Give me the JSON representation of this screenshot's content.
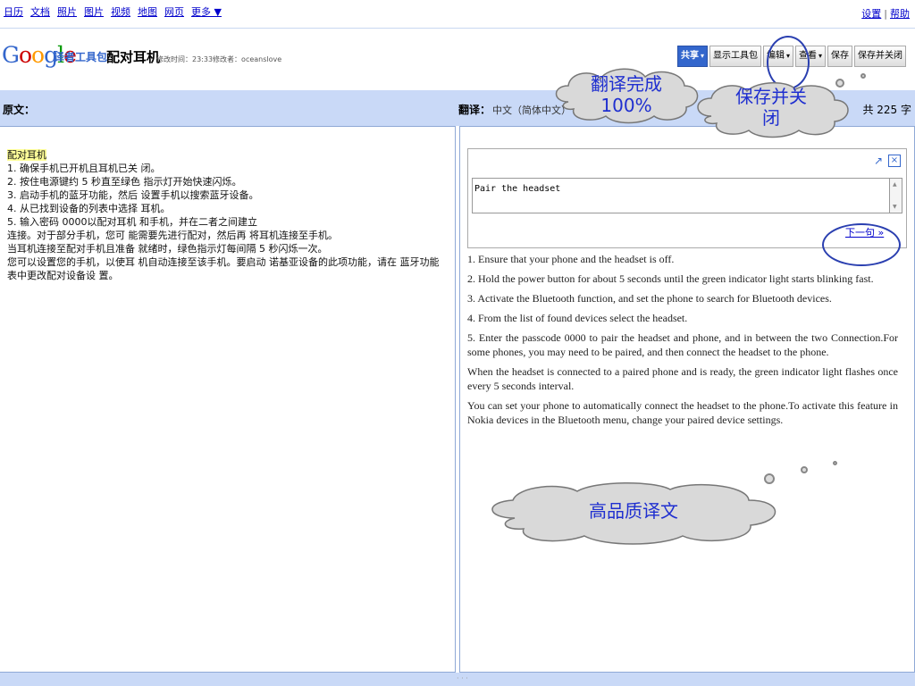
{
  "nav": {
    "links": [
      "日历",
      "文档",
      "照片",
      "图片",
      "视频",
      "地图",
      "网页",
      "更多 ▼"
    ],
    "settings": "设置",
    "sep": "|",
    "help": "帮助"
  },
  "header": {
    "logo_letters": [
      {
        "ch": "G",
        "color": "#3366cc"
      },
      {
        "ch": "o",
        "color": "#cc0000"
      },
      {
        "ch": "o",
        "color": "#ff9900"
      },
      {
        "ch": "g",
        "color": "#3366cc"
      },
      {
        "ch": "l",
        "color": "#009900"
      },
      {
        "ch": "e",
        "color": "#cc0000"
      }
    ],
    "toolkit": "译者工具包",
    "doc_title": "配对耳机",
    "meta": "修改时间：23:33修改者：oceanslove"
  },
  "toolbar": {
    "share": "共享",
    "show_toolkit": "显示工具包",
    "edit": "编辑",
    "view": "查看",
    "save": "保存",
    "save_close": "保存并关闭",
    "dropdown": "▾"
  },
  "columns": {
    "source_label": "原文：",
    "translation_label": "翻译：",
    "language": "中文（简体中文）",
    "word_count": "共 225 字"
  },
  "source": {
    "title": "配对耳机",
    "lines": [
      "1. 确保手机已开机且耳机已关 闭。",
      "2. 按住电源键约 5 秒直至绿色 指示灯开始快速闪烁。",
      "3. 启动手机的蓝牙功能，然后 设置手机以搜索蓝牙设备。",
      "4. 从已找到设备的列表中选择 耳机。",
      "5. 输入密码 0000以配对耳机 和手机，并在二者之间建立",
      "连接。对于部分手机，您可 能需要先进行配对，然后再 将耳机连接至手机。",
      "当耳机连接至配对手机且准备 就绪时，绿色指示灯每间隔 5 秒闪烁一次。",
      "您可以设置您的手机，以使耳 机自动连接至该手机。要启动 诺基亚设备的此项功能，请在 蓝牙功能",
      "表中更改配对设备设 置。"
    ]
  },
  "editor": {
    "popout_icon": "↗",
    "close_icon": "×",
    "value": "Pair the headset",
    "next": "下一句 »"
  },
  "translation": [
    "1. Ensure that your phone and the headset is off.",
    "2. Hold the power button for about 5 seconds until the green indicator light starts blinking fast.",
    "3. Activate the Bluetooth function, and set the phone to search for Bluetooth devices.",
    "4. From the list of found devices select the headset.",
    "5. Enter the passcode 0000 to pair the headset and phone, and in between the two Connection.For some phones, you may need to be paired, and then connect the headset to the phone.",
    "When the headset is connected to a paired phone and is ready, the green indicator light flashes once every 5 seconds interval.",
    "You can set your phone to automatically connect the headset to the phone.To activate this feature in Nokia devices in the Bluetooth menu, change your paired device settings."
  ],
  "callouts": {
    "done": "翻译完成 100%",
    "done_line1": "翻译完成",
    "done_line2": "100%",
    "save_close": "保存并关闭",
    "save_line1": "保存并关",
    "save_line2": "闭",
    "quality": "高品质译文"
  }
}
